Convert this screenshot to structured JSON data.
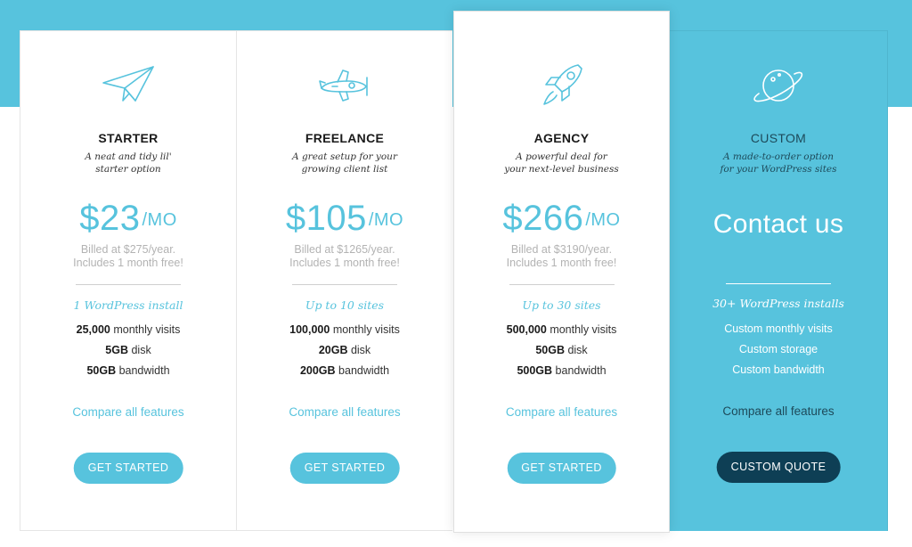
{
  "colors": {
    "accent": "#57c3dd",
    "dark_button": "#0e3f55",
    "dark_text": "#1d4a5a"
  },
  "plans": [
    {
      "icon": "paper-plane-icon",
      "name": "STARTER",
      "tagline": "A neat and tidy lil' starter option",
      "price": "$23",
      "per": "/MO",
      "billed_line1": "Billed at $275/year.",
      "billed_line2": "Includes 1 month free!",
      "installs": "1 WordPress install",
      "visits_value": "25,000",
      "visits_label": " monthly visits",
      "disk_value": "5GB",
      "disk_label": " disk",
      "bandwidth_value": "50GB",
      "bandwidth_label": " bandwidth",
      "compare": "Compare all features",
      "button": "GET STARTED"
    },
    {
      "icon": "propeller-plane-icon",
      "name": "FREELANCE",
      "tagline": "A great setup for your growing client list",
      "price": "$105",
      "per": "/MO",
      "billed_line1": "Billed at $1265/year.",
      "billed_line2": "Includes 1 month free!",
      "installs": "Up to 10 sites",
      "visits_value": "100,000",
      "visits_label": " monthly visits",
      "disk_value": "20GB",
      "disk_label": " disk",
      "bandwidth_value": "200GB",
      "bandwidth_label": " bandwidth",
      "compare": "Compare all features",
      "button": "GET STARTED"
    },
    {
      "icon": "rocket-icon",
      "name": "AGENCY",
      "tagline": "A powerful deal for your next-level business",
      "price": "$266",
      "per": "/MO",
      "billed_line1": "Billed at $3190/year.",
      "billed_line2": "Includes 1 month free!",
      "installs": "Up to 30 sites",
      "visits_value": "500,000",
      "visits_label": " monthly visits",
      "disk_value": "50GB",
      "disk_label": " disk",
      "bandwidth_value": "500GB",
      "bandwidth_label": " bandwidth",
      "compare": "Compare all features",
      "button": "GET STARTED"
    },
    {
      "icon": "planet-icon",
      "name": "CUSTOM",
      "tagline": "A made-to-order option for your WordPress sites",
      "contact": "Contact us",
      "installs": "30+ WordPress installs",
      "visits": "Custom monthly visits",
      "storage": "Custom storage",
      "bandwidth": "Custom bandwidth",
      "compare": "Compare all features",
      "button": "CUSTOM QUOTE"
    }
  ]
}
